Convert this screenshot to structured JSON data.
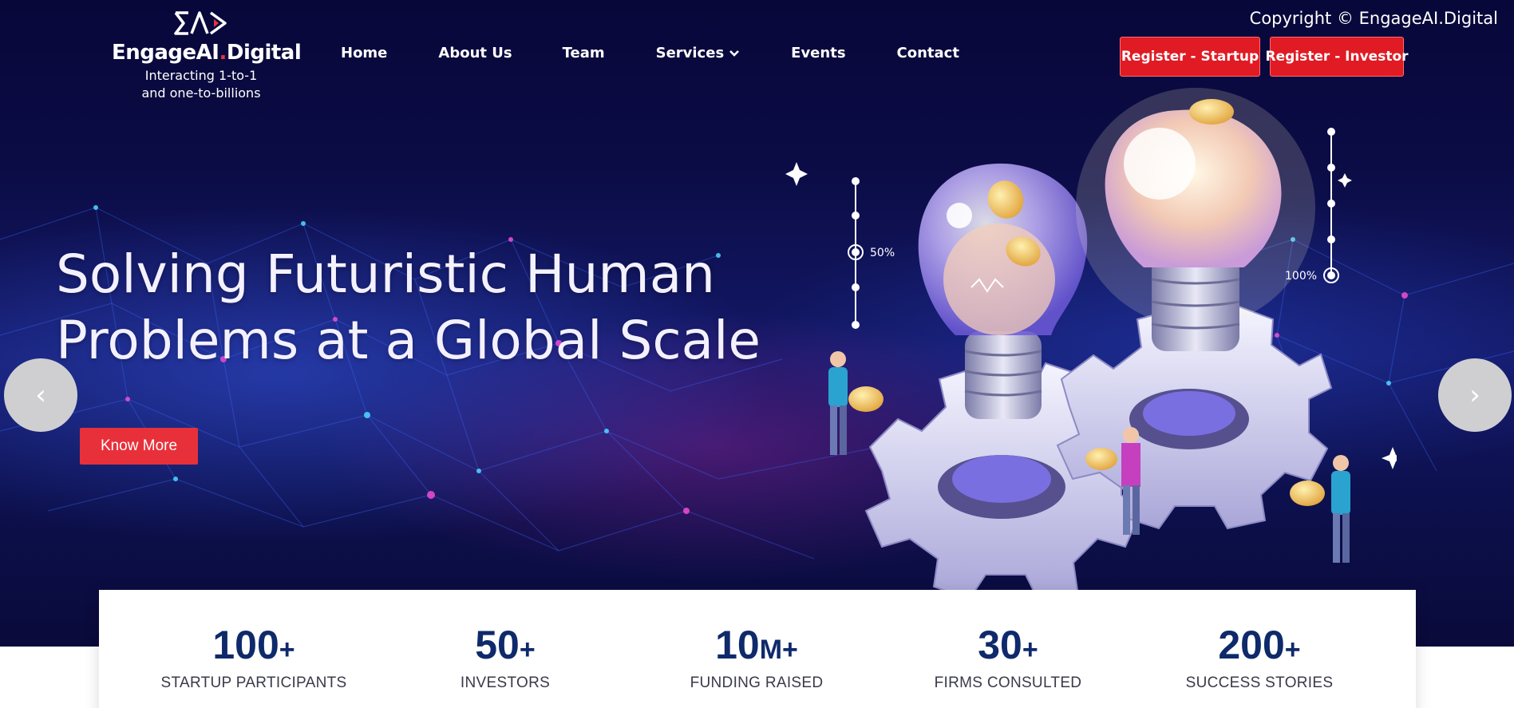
{
  "header": {
    "logo": {
      "name_main": "EngageAI",
      "name_dot": ".",
      "name_tail": "Digital",
      "tagline_line1": "Interacting 1-to-1",
      "tagline_line2": "and one-to-billions"
    },
    "nav": [
      {
        "label": "Home"
      },
      {
        "label": "About Us"
      },
      {
        "label": "Team"
      },
      {
        "label": "Services",
        "has_dropdown": true
      },
      {
        "label": "Events"
      },
      {
        "label": "Contact"
      }
    ],
    "copyright": "Copyright © EngageAI.Digital",
    "register_startup": "Register - Startup",
    "register_investor": "Register - Investor"
  },
  "hero": {
    "headline_line1": "Solving Futuristic Human",
    "headline_line2": "Problems at a Global Scale",
    "cta_label": "Know More",
    "prev_arrow": "‹",
    "next_arrow": "›",
    "illustration": {
      "gauge_left_label": "50%",
      "gauge_right_label": "100%",
      "icon": "lightbulb-gears-coins-illustration"
    }
  },
  "stats": [
    {
      "number": "100",
      "suffix": "+",
      "label": "STARTUP PARTICIPANTS"
    },
    {
      "number": "50",
      "suffix": "+",
      "label": "INVESTORS"
    },
    {
      "number": "10",
      "suffix": "M+",
      "label": "FUNDING RAISED"
    },
    {
      "number": "30",
      "suffix": "+",
      "label": "FIRMS CONSULTED"
    },
    {
      "number": "200",
      "suffix": "+",
      "label": "SUCCESS STORIES"
    }
  ],
  "colors": {
    "brand_red": "#e01b24",
    "hero_dark": "#0b0c45",
    "stat_blue": "#0f2a6b"
  }
}
